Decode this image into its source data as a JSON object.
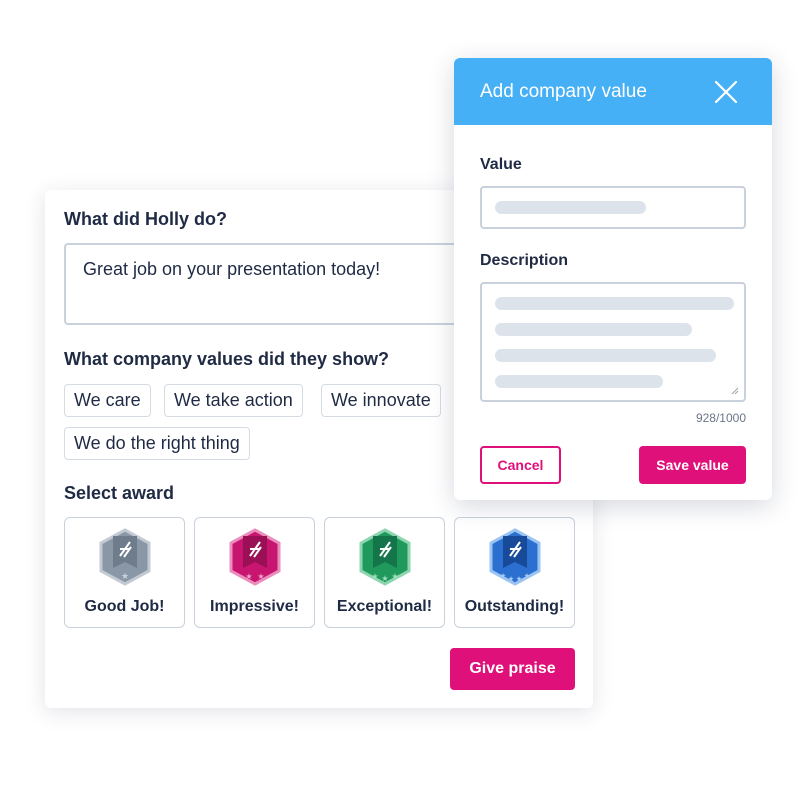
{
  "praise_form": {
    "question_what": "What did Holly do?",
    "praise_text": "Great job on your presentation today!",
    "question_values": "What company values did they show?",
    "values": [
      "We care",
      "We take action",
      "We innovate",
      "We do the right thing"
    ],
    "question_award": "Select award",
    "awards": [
      {
        "label": "Good Job!",
        "color": "#8a97a6",
        "icon": "badge-gray-icon"
      },
      {
        "label": "Impressive!",
        "color": "#c8156f",
        "icon": "badge-magenta-icon"
      },
      {
        "label": "Exceptional!",
        "color": "#1f9a5c",
        "icon": "badge-green-icon"
      },
      {
        "label": "Outstanding!",
        "color": "#2b6fd0",
        "icon": "badge-blue-icon"
      }
    ],
    "give_praise_label": "Give praise"
  },
  "modal": {
    "title": "Add company value",
    "value_label": "Value",
    "description_label": "Description",
    "char_count": "928/1000",
    "cancel_label": "Cancel",
    "save_label": "Save value"
  },
  "colors": {
    "accent": "#e0107a",
    "header": "#45b0f5",
    "text": "#1f2a44"
  }
}
